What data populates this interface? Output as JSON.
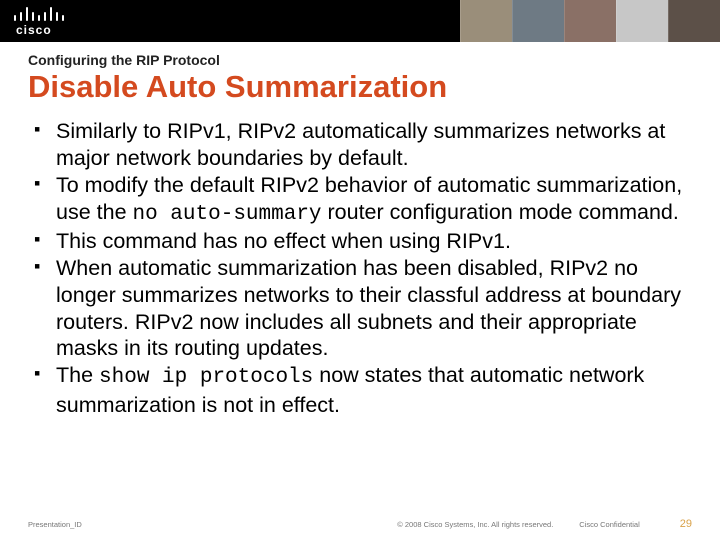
{
  "brand": "cisco",
  "header": {
    "kicker": "Configuring the RIP Protocol",
    "title": "Disable Auto Summarization"
  },
  "bullets": [
    {
      "pre": "Similarly to RIPv1, RIPv2 automatically summarizes networks at major network boundaries by default."
    },
    {
      "pre": "To modify the default RIPv2 behavior of automatic summarization, use the ",
      "code": "no auto-summary",
      "post": " router configuration mode command."
    },
    {
      "pre": "This command has no effect when using RIPv1."
    },
    {
      "pre": "When automatic summarization has been disabled, RIPv2 no longer summarizes networks to their classful address at boundary routers. RIPv2 now includes all subnets and their appropriate masks in its routing updates."
    },
    {
      "pre": "The ",
      "code": "show ip protocols",
      "post": " now states that automatic network summarization is not in effect."
    }
  ],
  "footer": {
    "presentation_id": "Presentation_ID",
    "copyright": "© 2008 Cisco Systems, Inc. All rights reserved.",
    "confidential": "Cisco Confidential",
    "page": "29"
  }
}
